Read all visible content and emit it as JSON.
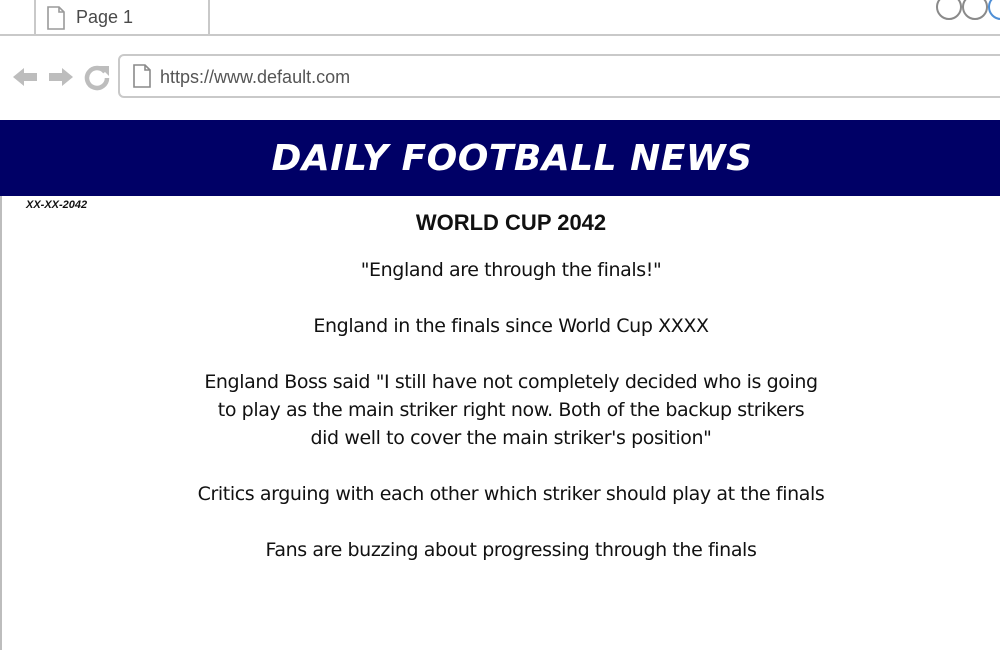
{
  "browser": {
    "tab": {
      "label": "Page 1",
      "icon": "page-icon"
    },
    "url": "https://www.default.com",
    "nav_icons": [
      "back-arrow-icon",
      "forward-arrow-icon",
      "reload-icon",
      "page-icon"
    ],
    "window_controls": [
      "circle-control",
      "circle-control",
      "circle-control"
    ]
  },
  "page": {
    "banner_title": "DAILY FOOTBALL NEWS",
    "banner_color": "#000066",
    "date": "XX-XX-2042",
    "headline": "WORLD CUP 2042",
    "paragraphs": [
      "\"England are through the finals!\"",
      "England in the finals since World Cup XXXX",
      "England Boss said \"I still have not completely decided who is going to play as the main striker right now. Both of the backup strikers did well to cover the main striker's position\"",
      "Critics arguing with each other which striker should play at the finals",
      "Fans are buzzing about progressing through the finals"
    ]
  }
}
